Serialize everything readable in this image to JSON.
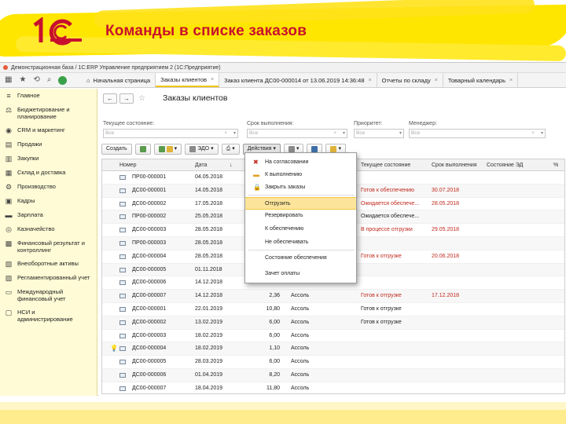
{
  "slide": {
    "title": "Команды в списке заказов",
    "logo": "1С"
  },
  "window": {
    "title": "Демонстрационная база / 1С:ERP Управление предприятием 2  (1С:Предприятие)"
  },
  "tabs": [
    {
      "label": "Начальная страница"
    },
    {
      "label": "Заказы клиентов"
    },
    {
      "label": "Заказ клиента ДС00-000014 от 13.06.2019 14:36:48"
    },
    {
      "label": "Отчеты по складу"
    },
    {
      "label": "Товарный календарь"
    }
  ],
  "sidebar": {
    "items": [
      {
        "label": "Главное",
        "icon": "menu-icon"
      },
      {
        "label": "Бюджетирование и планирование",
        "icon": "budget-icon"
      },
      {
        "label": "CRM и маркетинг",
        "icon": "crm-icon"
      },
      {
        "label": "Продажи",
        "icon": "sales-icon"
      },
      {
        "label": "Закупки",
        "icon": "purchase-icon"
      },
      {
        "label": "Склад и доставка",
        "icon": "warehouse-icon"
      },
      {
        "label": "Производство",
        "icon": "production-icon"
      },
      {
        "label": "Кадры",
        "icon": "hr-icon"
      },
      {
        "label": "Зарплата",
        "icon": "salary-icon"
      },
      {
        "label": "Казначейство",
        "icon": "treasury-icon"
      },
      {
        "label": "Финансовый результат и контроллинг",
        "icon": "finance-icon"
      },
      {
        "label": "Внеоборотные активы",
        "icon": "assets-icon"
      },
      {
        "label": "Регламентированный учет",
        "icon": "accounting-icon"
      },
      {
        "label": "Международный финансовый учет",
        "icon": "intl-icon"
      },
      {
        "label": "НСИ и администрирование",
        "icon": "admin-icon"
      }
    ]
  },
  "form": {
    "title": "Заказы клиентов",
    "filters": {
      "state_label": "Текущее состояние:",
      "state_value": "Все",
      "deadline_label": "Срок выполнения:",
      "deadline_value": "Все",
      "priority_label": "Приоритет:",
      "priority_value": "Все",
      "manager_label": "Менеджер:",
      "manager_value": "Все"
    },
    "toolbar": {
      "create": "Создать",
      "edo": "ЭДО",
      "actions": "Действия"
    }
  },
  "columns": {
    "number": "Номер",
    "date": "Дата",
    "state": "Текущее состояние",
    "deadline": "Срок выполнения",
    "ed_state": "Состояние ЭД",
    "percent": "%"
  },
  "rows": [
    {
      "number": "ПР00-000001",
      "date": "04.05.2018",
      "amount": "",
      "client": "",
      "state": "",
      "deadline": ""
    },
    {
      "number": "ДС00-000001",
      "date": "14.05.2018",
      "amount": "",
      "client": "",
      "state": "Готов к обеспечению",
      "deadline": "30.07.2018",
      "red": true
    },
    {
      "number": "ДС00-000002",
      "date": "17.05.2018",
      "amount": "",
      "client": "",
      "state": "Ожидается обеспече...",
      "deadline": "28.05.2018",
      "red": true
    },
    {
      "number": "ПР00-000002",
      "date": "25.05.2018",
      "amount": "",
      "client": "",
      "state": "Ожидается обеспече...",
      "deadline": "",
      "red": false
    },
    {
      "number": "ДС00-000003",
      "date": "28.05.2018",
      "amount": "",
      "client": "",
      "state": "В процессе отгрузки",
      "deadline": "29.05.2018",
      "red": true
    },
    {
      "number": "ПР00-000003",
      "date": "28.05.2018",
      "amount": "",
      "client": "",
      "state": "",
      "deadline": ""
    },
    {
      "number": "ДС00-000004",
      "date": "28.05.2018",
      "amount": "",
      "client": "",
      "state": "Готов к отгрузке",
      "deadline": "20.06.2018",
      "red": true
    },
    {
      "number": "ДС00-000005",
      "date": "01.11.2018",
      "amount": "",
      "client": "",
      "state": "",
      "deadline": ""
    },
    {
      "number": "ДС00-000006",
      "date": "14.12.2018",
      "amount": "",
      "client": "",
      "state": "",
      "deadline": ""
    },
    {
      "number": "ДС00-000007",
      "date": "14.12.2018",
      "amount": "2,36",
      "client": "Ассоль",
      "state": "Готов к отгрузке",
      "deadline": "17.12.2018",
      "red": true
    },
    {
      "number": "ДС00-000001",
      "date": "22.01.2019",
      "amount": "10,80",
      "client": "Ассоль",
      "state": "Готов к отгрузке",
      "deadline": "",
      "red": false
    },
    {
      "number": "ДС00-000002",
      "date": "13.02.2019",
      "amount": "6,00",
      "client": "Ассоль",
      "state": "Готов к отгрузке",
      "deadline": "",
      "red": false
    },
    {
      "number": "ДС00-000003",
      "date": "18.02.2019",
      "amount": "6,00",
      "client": "Ассоль",
      "state": "",
      "deadline": ""
    },
    {
      "number": "ДС00-000004",
      "date": "18.02.2019",
      "amount": "1,10",
      "client": "Ассоль",
      "state": "",
      "deadline": "",
      "bulb": true
    },
    {
      "number": "ДС00-000005",
      "date": "28.03.2019",
      "amount": "6,00",
      "client": "Ассоль",
      "state": "",
      "deadline": ""
    },
    {
      "number": "ДС00-000006",
      "date": "01.04.2019",
      "amount": "8,20",
      "client": "Ассоль",
      "state": "",
      "deadline": ""
    },
    {
      "number": "ДС00-000007",
      "date": "18.04.2019",
      "amount": "11,80",
      "client": "Ассоль",
      "state": "",
      "deadline": ""
    }
  ],
  "popup": {
    "items": [
      {
        "label": "На согласовании",
        "icon": "x-icon"
      },
      {
        "label": "К выполнению",
        "icon": "folder-icon"
      },
      {
        "label": "Закрыть заказы",
        "icon": "lock-icon"
      },
      {
        "label": "Отгрузить",
        "highlighted": true
      },
      {
        "label": "Резервировать"
      },
      {
        "label": "К обеспечению"
      },
      {
        "label": "Не обеспечивать"
      },
      {
        "label": "Состояние обеспечения"
      },
      {
        "label": "Зачет оплаты"
      }
    ]
  }
}
